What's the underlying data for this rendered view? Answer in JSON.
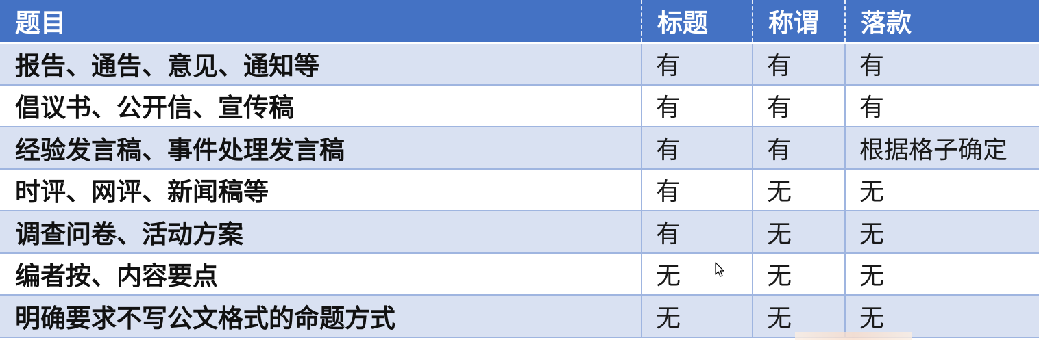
{
  "header": {
    "col1": "题目",
    "col2": "标题",
    "col3": "称谓",
    "col4": "落款"
  },
  "rows": [
    {
      "topic": "报告、通告、意见、通知等",
      "title": "有",
      "salutation": "有",
      "signature": "有"
    },
    {
      "topic": "倡议书、公开信、宣传稿",
      "title": "有",
      "salutation": "有",
      "signature": "有"
    },
    {
      "topic": "经验发言稿、事件处理发言稿",
      "title": "有",
      "salutation": "有",
      "signature": "根据格子确定"
    },
    {
      "topic": "时评、网评、新闻稿等",
      "title": "有",
      "salutation": "无",
      "signature": "无"
    },
    {
      "topic": "调查问卷、活动方案",
      "title": "有",
      "salutation": "无",
      "signature": "无"
    },
    {
      "topic": "编者按、内容要点",
      "title": "无",
      "salutation": "无",
      "signature": "无"
    },
    {
      "topic": "明确要求不写公文格式的命题方式",
      "title": "无",
      "salutation": "无",
      "signature": "无"
    }
  ],
  "colors": {
    "header_bg": "#4472c4",
    "row_alt_bg": "#d9e1f2",
    "grid_line": "#9fb5e0"
  },
  "icons": {
    "cursor": "mouse-pointer-icon"
  }
}
